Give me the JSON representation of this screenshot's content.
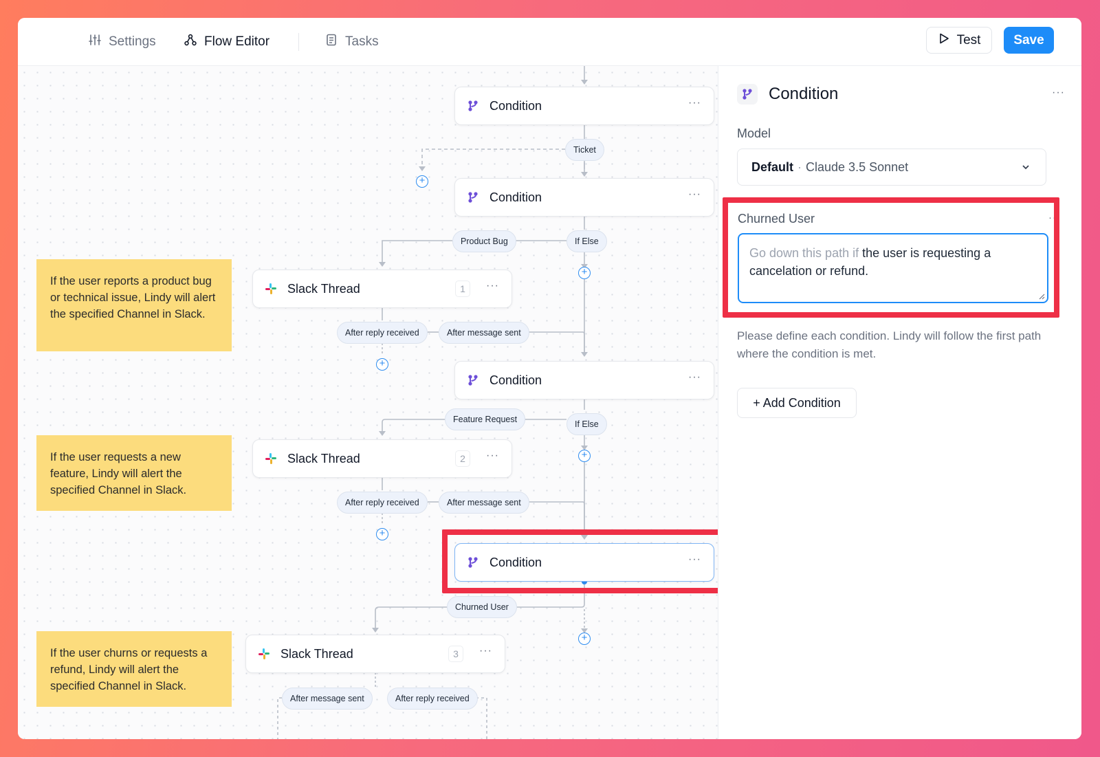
{
  "nav": {
    "tabs": [
      {
        "label": "Settings",
        "icon": "sliders-icon",
        "active": false
      },
      {
        "label": "Flow Editor",
        "icon": "flow-icon",
        "active": true
      },
      {
        "label": "Tasks",
        "icon": "document-icon",
        "active": false
      }
    ],
    "test_label": "Test",
    "save_label": "Save"
  },
  "canvas": {
    "nodes": [
      {
        "type": "condition",
        "title": "Condition"
      },
      {
        "type": "condition",
        "title": "Condition"
      },
      {
        "type": "slack",
        "title": "Slack Thread",
        "count": "1"
      },
      {
        "type": "condition",
        "title": "Condition"
      },
      {
        "type": "slack",
        "title": "Slack Thread",
        "count": "2"
      },
      {
        "type": "condition",
        "title": "Condition",
        "selected": true
      },
      {
        "type": "slack",
        "title": "Slack Thread",
        "count": "3"
      }
    ],
    "branch_labels": [
      "Ticket",
      "Product Bug",
      "If Else",
      "After reply received",
      "After message sent",
      "Feature Request",
      "If Else",
      "After reply received",
      "After message sent",
      "Churned User",
      "After message sent",
      "After reply received"
    ],
    "notes": [
      "If the user reports a product bug or technical issue, Lindy will alert the specified Channel in Slack.",
      "If the user requests a new feature, Lindy will alert the specified Channel in Slack.",
      "If the user churns or requests a refund, Lindy will alert the specified Channel in Slack."
    ]
  },
  "panel": {
    "title": "Condition",
    "model_label": "Model",
    "model_default": "Default",
    "model_separator": "·",
    "model_name": "Claude 3.5 Sonnet",
    "condition_name": "Churned User",
    "condition_prefix": "Go down this path if ",
    "condition_text": "the user is requesting a cancelation or refund.",
    "help_text": "Please define each condition. Lindy will follow the first path where the condition is met.",
    "add_condition_label": "+ Add Condition"
  },
  "colors": {
    "accent": "#1d8cf8",
    "highlight": "#ee2f46",
    "note": "#fcdc7d",
    "condition_icon": "#6d4fd8"
  }
}
